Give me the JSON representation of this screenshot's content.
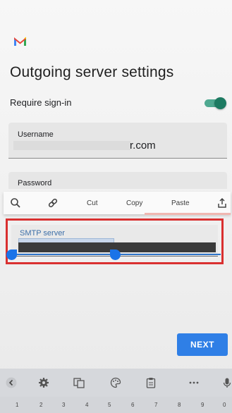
{
  "header": {
    "logo": "gmail-m-logo",
    "title": "Outgoing server settings"
  },
  "require_signin": {
    "label": "Require sign-in",
    "enabled": true
  },
  "username": {
    "label": "Username",
    "value_suffix": "r.com"
  },
  "password": {
    "label": "Password"
  },
  "text_actions": {
    "icons": [
      "search-icon",
      "link-icon",
      "share-icon"
    ],
    "cut": "Cut",
    "copy": "Copy",
    "paste": "Paste"
  },
  "smtp": {
    "label": "SMTP server"
  },
  "next_button": {
    "label": "NEXT"
  },
  "keyboard": {
    "toolbar_icons": [
      "chevron-left-icon",
      "gear-icon",
      "translate-icon",
      "palette-icon",
      "clipboard-icon",
      "more-icon",
      "mic-icon"
    ],
    "number_hints": [
      "1",
      "2",
      "3",
      "4",
      "5",
      "6",
      "7",
      "8",
      "9",
      "0"
    ]
  },
  "colors": {
    "accent_blue": "#2f7fe6",
    "toggle_green": "#1d7a61",
    "highlight_red": "#d93030"
  }
}
